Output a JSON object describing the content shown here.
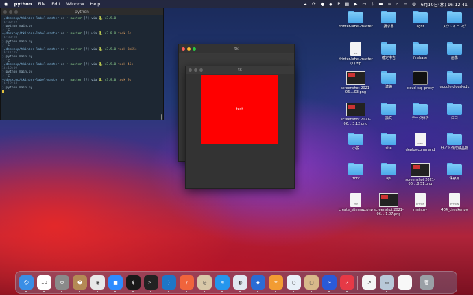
{
  "menubar": {
    "apple_icon": "apple-icon",
    "app_name": "python",
    "menus": [
      "File",
      "Edit",
      "Window",
      "Help"
    ],
    "clock": "6月10日(木)  16:12:41"
  },
  "terminal": {
    "title": "python",
    "lines": [
      {
        "time": "16:08:12",
        "path": "~/desktop/tkinter-label-master",
        "branch": "master",
        "ver": "v3.9.0",
        "took": ""
      },
      {
        "cmd": "python main.py"
      },
      {
        "cmd": "^C"
      },
      {
        "time": "16:09:18",
        "path": "~/desktop/tkinter-label-master",
        "branch": "master",
        "ver": "v3.9.0",
        "took": "took 5s"
      },
      {
        "cmd": "python main.py"
      },
      {
        "cmd": "^C"
      },
      {
        "time": "16:11:15",
        "path": "~/desktop/tkinter-label-master",
        "branch": "master",
        "ver": "v3.9.0",
        "took": "took 3m55s"
      },
      {
        "cmd": "python main.py"
      },
      {
        "cmd": "^C"
      },
      {
        "time": "16:12:09",
        "path": "~/desktop/tkinter-label-master",
        "branch": "master",
        "ver": "v3.9.0",
        "took": "took 45s"
      },
      {
        "cmd": "python main.py"
      },
      {
        "cmd": "^C"
      },
      {
        "time": "16:12:34",
        "path": "~/desktop/tkinter-label-master",
        "branch": "master",
        "ver": "v3.9.0",
        "took": "took 9s"
      },
      {
        "cmd": "python main.py"
      }
    ]
  },
  "tk_back": {
    "title": "tk"
  },
  "tk_front": {
    "title": "tk",
    "label_text": "test",
    "label_bg": "#ff0000"
  },
  "desktop": [
    {
      "label": "tkinter-label-master",
      "kind": "folder"
    },
    {
      "label": "請求書",
      "kind": "folder"
    },
    {
      "label": "light",
      "kind": "folder"
    },
    {
      "label": "スクレイピング",
      "kind": "folder"
    },
    {
      "label": "tkinter-label-master (1).zip",
      "kind": "doc",
      "tag": "ZIP"
    },
    {
      "label": "確定申告",
      "kind": "folder"
    },
    {
      "label": "firebase",
      "kind": "folder"
    },
    {
      "label": "画像",
      "kind": "folder"
    },
    {
      "label": "screenshot 2021-06....03.png",
      "kind": "shot"
    },
    {
      "label": "連絡",
      "kind": "folder"
    },
    {
      "label": "cloud_sql_proxy",
      "kind": "term"
    },
    {
      "label": "google-cloud-sdk",
      "kind": "folder"
    },
    {
      "label": "screenshot 2021-06....3.12.png",
      "kind": "shot"
    },
    {
      "label": "論文",
      "kind": "folder"
    },
    {
      "label": "データ分析",
      "kind": "folder"
    },
    {
      "label": "ロゴ",
      "kind": "folder"
    },
    {
      "label": "小説",
      "kind": "folder"
    },
    {
      "label": "site",
      "kind": "folder"
    },
    {
      "label": "deploy.command",
      "kind": "doc",
      "tag": "SHELL"
    },
    {
      "label": "サイト作成納品物",
      "kind": "folder"
    },
    {
      "label": "front",
      "kind": "folder"
    },
    {
      "label": "api",
      "kind": "folder"
    },
    {
      "label": "screenshot 2021-06....8.51.png",
      "kind": "shot"
    },
    {
      "label": "保存用",
      "kind": "folder"
    },
    {
      "label": "create_sitemap.php",
      "kind": "doc",
      "tag": "PHP"
    },
    {
      "label": "screenshot 2021-06....1.07.png",
      "kind": "shot"
    },
    {
      "label": "main.py",
      "kind": "doc",
      "tag": "PYTHON"
    },
    {
      "label": "404_checker.py",
      "kind": "doc",
      "tag": "PYTHON"
    }
  ],
  "dock": {
    "items": [
      {
        "name": "finder",
        "color": "#3a8ee6",
        "glyph": "☺"
      },
      {
        "name": "calendar",
        "color": "#ffffff",
        "glyph": "10"
      },
      {
        "name": "system-preferences",
        "color": "#8a8a8a",
        "glyph": "⚙"
      },
      {
        "name": "contacts",
        "color": "#b48a55",
        "glyph": "☻"
      },
      {
        "name": "chrome",
        "color": "#e8e8e8",
        "glyph": "◉"
      },
      {
        "name": "zoom",
        "color": "#2d8cff",
        "glyph": "■"
      },
      {
        "name": "iterm",
        "color": "#1a1a1a",
        "glyph": "$"
      },
      {
        "name": "terminal",
        "color": "#222222",
        "glyph": ">_"
      },
      {
        "name": "vscode",
        "color": "#1e76c7",
        "glyph": "⟩"
      },
      {
        "name": "swift-playgrounds",
        "color": "#f0643c",
        "glyph": "/"
      },
      {
        "name": "sequel-pro",
        "color": "#d8c8a8",
        "glyph": "◎"
      },
      {
        "name": "docker",
        "color": "#2496ed",
        "glyph": "≋"
      },
      {
        "name": "safari-browser",
        "color": "#e0e8f0",
        "glyph": "◐"
      },
      {
        "name": "sourcetree",
        "color": "#2b6cd4",
        "glyph": "◆"
      },
      {
        "name": "github-desktop",
        "color": "#f29c33",
        "glyph": "⟡"
      },
      {
        "name": "navigator",
        "color": "#e8f0f8",
        "glyph": "○"
      },
      {
        "name": "preview",
        "color": "#d8b88a",
        "glyph": "▢"
      },
      {
        "name": "infinity",
        "color": "#2a5ad8",
        "glyph": "∞"
      },
      {
        "name": "clock-app",
        "color": "#e63946",
        "glyph": "✓"
      },
      {
        "name": "activity",
        "color": "#f5f5f5",
        "glyph": "↗"
      },
      {
        "name": "screenshot-app",
        "color": "#b8c8d8",
        "glyph": "▭"
      },
      {
        "name": "document",
        "color": "#f8f8f8",
        "glyph": " "
      },
      {
        "name": "trash",
        "color": "#9aa0a6",
        "glyph": "🗑"
      }
    ]
  }
}
